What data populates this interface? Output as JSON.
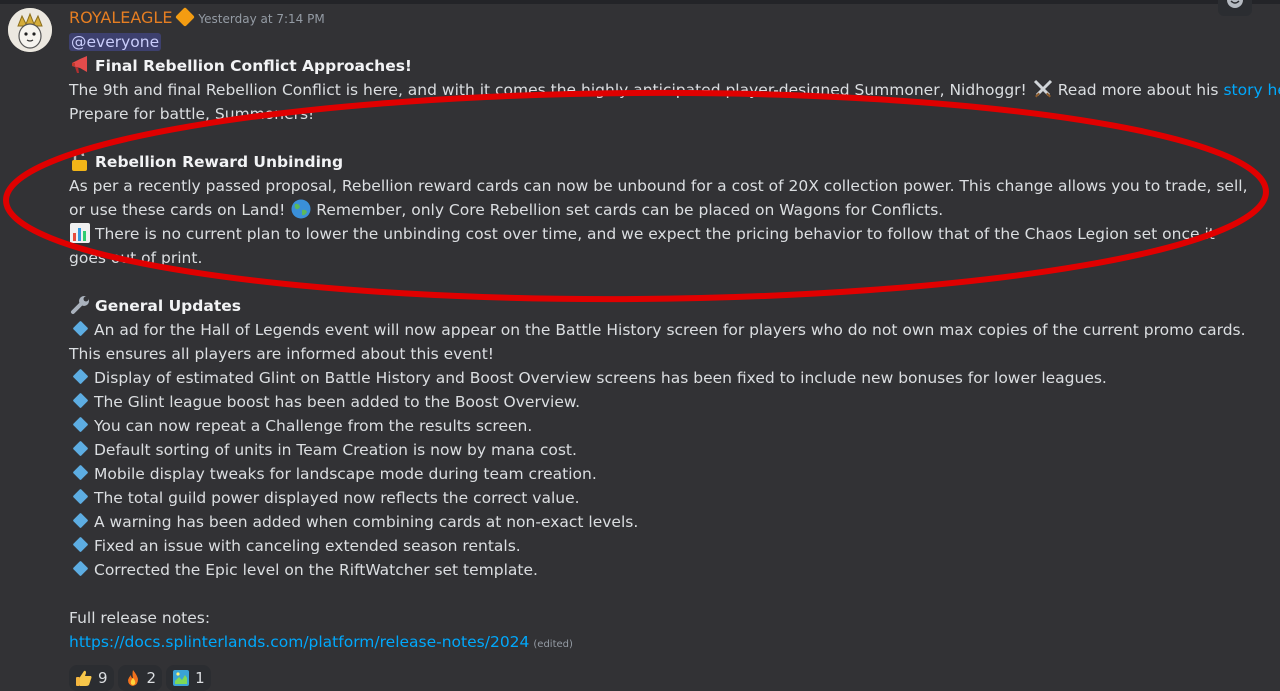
{
  "author": {
    "name": "ROYALEAGLE",
    "timestamp": "Yesterday at 7:14 PM"
  },
  "mention": "@everyone",
  "section1": {
    "heading": "Final Rebellion Conflict Approaches!",
    "line1_text": "The 9th and final Rebellion Conflict is here, and with it comes the highly anticipated player-designed Summoner, Nidhoggr!",
    "line1_cont": "Read more about his",
    "link": "story here.",
    "line2": "Prepare for battle, Summoners!"
  },
  "section2": {
    "heading": "Rebellion Reward Unbinding",
    "para1_a": "As per a recently passed proposal, Rebellion reward cards can now be unbound for a cost of 20X collection power. This change allows you to trade, sell, or use these cards on Land!",
    "para1_b": "Remember, only Core Rebellion set cards can be placed on Wagons for Conflicts.",
    "para2": "There is no current plan to lower the unbinding cost over time, and we expect the pricing behavior to follow that of the Chaos Legion set once it goes out of print."
  },
  "section3": {
    "heading": "General Updates",
    "items": [
      "An ad for the Hall of Legends event will now appear on the Battle History screen for players who do not own max copies of the current promo cards. This ensures all players are informed about this event!",
      "Display of estimated Glint on Battle History and Boost Overview screens has been fixed to include new bonuses for lower leagues.",
      "The Glint league boost has been added to the Boost Overview.",
      "You can now repeat a Challenge from the results screen.",
      "Default sorting of units in Team Creation is now by mana cost.",
      "Mobile display tweaks for landscape mode during team creation.",
      "The total guild power displayed now reflects the correct value.",
      "A warning has been added when combining cards at non-exact levels.",
      "Fixed an issue with canceling extended season rentals.",
      "Corrected the Epic level on the RiftWatcher set template."
    ]
  },
  "footer": {
    "label": "Full release notes:",
    "url": "https://docs.splinterlands.com/platform/release-notes/2024",
    "edited": "(edited)"
  },
  "reactions": [
    {
      "icon": "thumbs-up-icon",
      "count": "9"
    },
    {
      "icon": "fire-icon",
      "count": "2"
    },
    {
      "icon": "custom-emoji-icon",
      "count": "1"
    }
  ],
  "colors": {
    "background": "#323235",
    "username": "#e67e22",
    "link": "#00a8fc",
    "annotation": "#e00000"
  }
}
